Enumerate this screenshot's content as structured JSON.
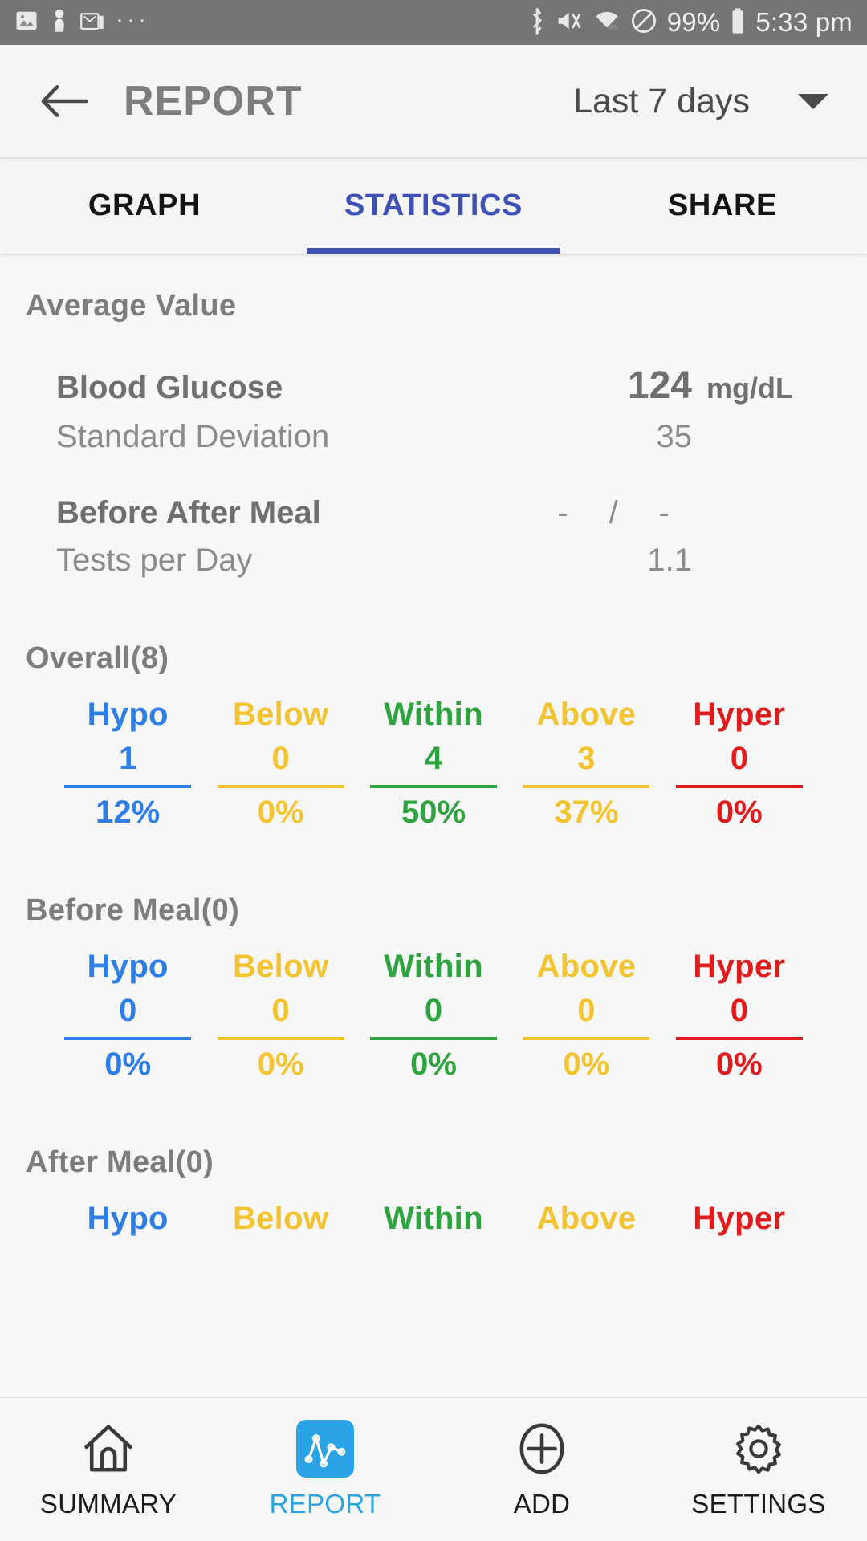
{
  "statusbar": {
    "icons_left": [
      "image-icon",
      "person-icon",
      "gmail-icon",
      "more-dots-icon"
    ],
    "icons_right": [
      "bluetooth-icon",
      "mute-icon",
      "wifi-icon",
      "dnd-icon"
    ],
    "battery_percent": "99%",
    "battery_icon": "battery-icon",
    "time": "5:33 pm"
  },
  "appbar": {
    "back_icon": "back-arrow-icon",
    "title": "REPORT",
    "range_label": "Last 7 days",
    "caret_icon": "chevron-down-icon"
  },
  "tabs": [
    {
      "label": "GRAPH",
      "active": false
    },
    {
      "label": "STATISTICS",
      "active": true
    },
    {
      "label": "SHARE",
      "active": false
    }
  ],
  "average": {
    "title": "Average Value",
    "rows": [
      {
        "name": "Blood Glucose",
        "value": "124",
        "unit": "mg/dL"
      },
      {
        "name": "Standard Deviation",
        "value": "35",
        "unit": ""
      }
    ],
    "before_after": {
      "name": "Before After Meal",
      "before": "-",
      "separator": "/",
      "after": "-"
    },
    "tests_per_day": {
      "name": "Tests per Day",
      "value": "1.1"
    }
  },
  "colors": {
    "hypo": "#2e7ee8",
    "below": "#f4c430",
    "within": "#2ea33f",
    "above": "#f4c430",
    "hyper": "#e01b1b",
    "accent_tab": "#3f51b5",
    "accent_nav": "#29a3e3",
    "title_gray": "#7d7d7d"
  },
  "groups": [
    {
      "title": "Overall(8)",
      "columns": [
        {
          "label": "Hypo",
          "count": "1",
          "percent": "12%",
          "color": "#2e7ee8"
        },
        {
          "label": "Below",
          "count": "0",
          "percent": "0%",
          "color": "#f4c430"
        },
        {
          "label": "Within",
          "count": "4",
          "percent": "50%",
          "color": "#2ea33f"
        },
        {
          "label": "Above",
          "count": "3",
          "percent": "37%",
          "color": "#f4c430"
        },
        {
          "label": "Hyper",
          "count": "0",
          "percent": "0%",
          "color": "#e01b1b"
        }
      ]
    },
    {
      "title": "Before Meal(0)",
      "columns": [
        {
          "label": "Hypo",
          "count": "0",
          "percent": "0%",
          "color": "#2e7ee8"
        },
        {
          "label": "Below",
          "count": "0",
          "percent": "0%",
          "color": "#f4c430"
        },
        {
          "label": "Within",
          "count": "0",
          "percent": "0%",
          "color": "#2ea33f"
        },
        {
          "label": "Above",
          "count": "0",
          "percent": "0%",
          "color": "#f4c430"
        },
        {
          "label": "Hyper",
          "count": "0",
          "percent": "0%",
          "color": "#e01b1b"
        }
      ]
    },
    {
      "title": "After Meal(0)",
      "columns": [
        {
          "label": "Hypo",
          "count": "",
          "percent": "",
          "color": "#2e7ee8"
        },
        {
          "label": "Below",
          "count": "",
          "percent": "",
          "color": "#f4c430"
        },
        {
          "label": "Within",
          "count": "",
          "percent": "",
          "color": "#2ea33f"
        },
        {
          "label": "Above",
          "count": "",
          "percent": "",
          "color": "#f4c430"
        },
        {
          "label": "Hyper",
          "count": "",
          "percent": "",
          "color": "#e01b1b"
        }
      ]
    }
  ],
  "bottomnav": [
    {
      "label": "SUMMARY",
      "icon": "home-icon",
      "active": false
    },
    {
      "label": "REPORT",
      "icon": "chart-icon",
      "active": true
    },
    {
      "label": "ADD",
      "icon": "plus-circle-icon",
      "active": false
    },
    {
      "label": "SETTINGS",
      "icon": "gear-icon",
      "active": false
    }
  ]
}
